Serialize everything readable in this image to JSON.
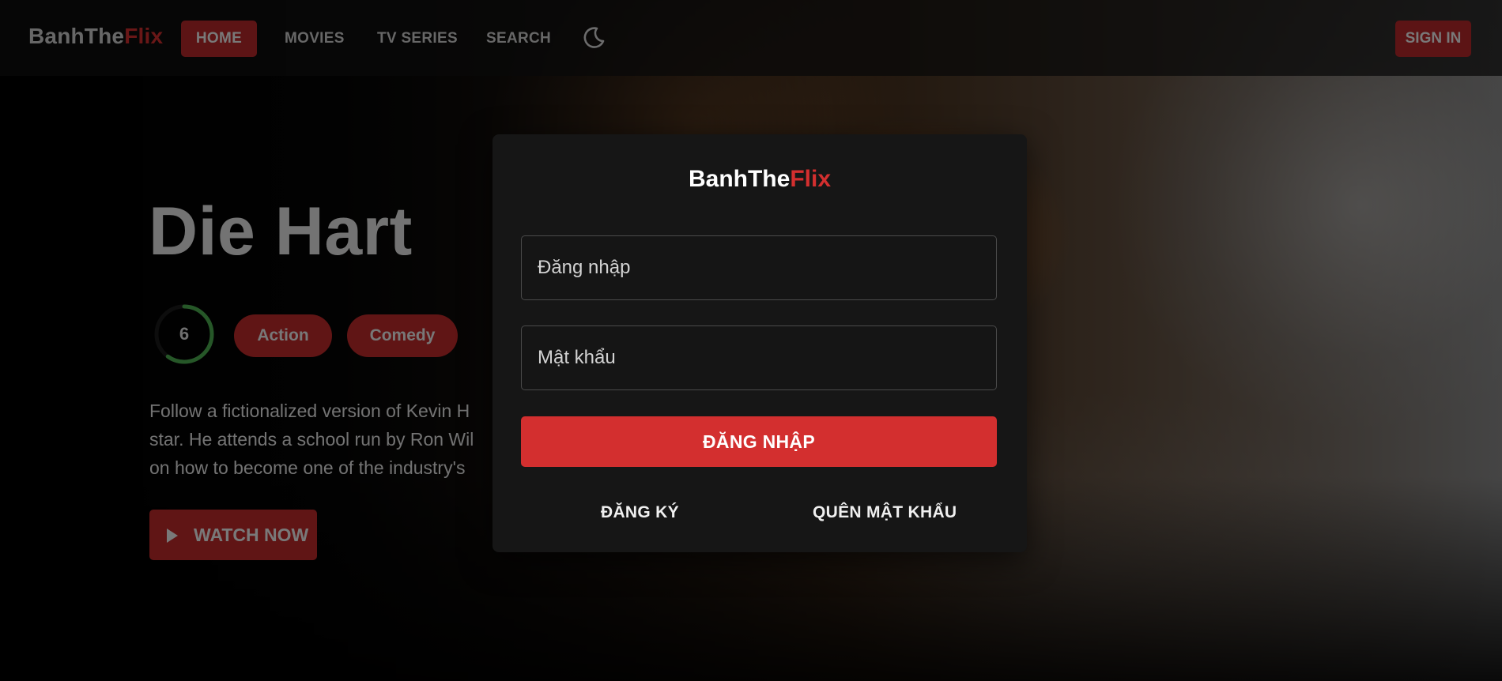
{
  "brand": {
    "prefix": "BanhThe",
    "suffix": "Flix"
  },
  "nav": {
    "items": [
      {
        "label": "HOME",
        "active": true
      },
      {
        "label": "MOVIES"
      },
      {
        "label": "TV SERIES"
      },
      {
        "label": "SEARCH"
      }
    ],
    "theme_toggle_icon": "moon-icon",
    "sign_in_label": "SIGN IN"
  },
  "hero": {
    "title": "Die Hart",
    "rating": "6",
    "rating_fraction": 0.6,
    "genres": [
      "Action",
      "Comedy"
    ],
    "overview_lines": [
      "Follow a fictionalized version of Kevin H",
      "star. He attends a school run by Ron Wil",
      "on how to become one of the industry's"
    ],
    "watch_label": "WATCH NOW",
    "watch_icon": "play-icon"
  },
  "login_modal": {
    "brand_prefix": "BanhThe",
    "brand_suffix": "Flix",
    "username_placeholder": "Đăng nhập",
    "password_placeholder": "Mật khẩu",
    "submit_label": "ĐĂNG NHẬP",
    "register_label": "ĐĂNG KÝ",
    "forgot_label": "QUÊN MẬT KHẨU"
  },
  "colors": {
    "accent": "#d32f2f",
    "accent_dark": "#b8282a",
    "rating_ring": "#4caf50",
    "modal_bg": "#161616"
  }
}
